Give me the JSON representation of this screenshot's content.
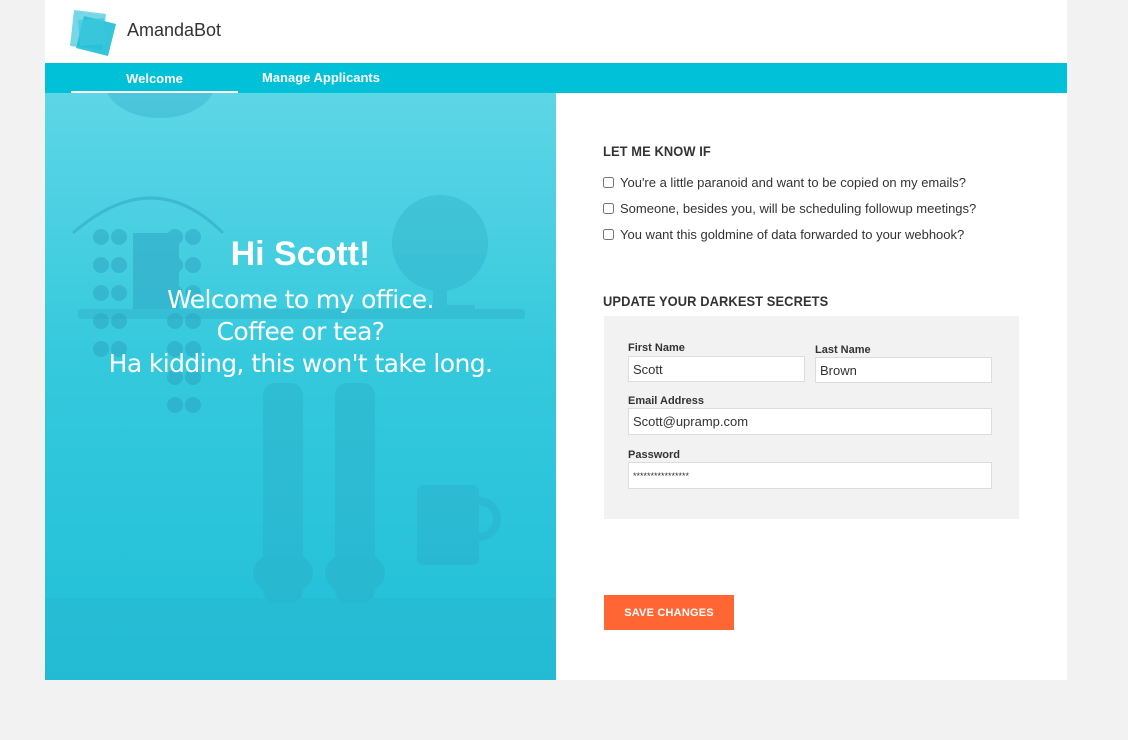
{
  "header": {
    "brand": "AmandaBot"
  },
  "nav": {
    "tabs": [
      {
        "label": "Welcome",
        "active": true
      },
      {
        "label": "Manage Applicants",
        "active": false
      }
    ]
  },
  "hero": {
    "title": "Hi Scott!",
    "lines": [
      "Welcome to my office.",
      "Coffee or tea?",
      "Ha kidding, this won't take long."
    ]
  },
  "notify": {
    "title": "LET ME KNOW IF",
    "options": [
      "You're a little paranoid and want to be copied on my emails?",
      "Someone, besides you, will be scheduling followup meetings?",
      "You want this goldmine of data forwarded to your webhook?"
    ]
  },
  "profile": {
    "title": "UPDATE YOUR DARKEST SECRETS",
    "first_name_label": "First Name",
    "first_name_value": "Scott",
    "last_name_label": "Last Name",
    "last_name_value": "Brown",
    "email_label": "Email Address",
    "email_value": "Scott@upramp.com",
    "password_label": "Password",
    "password_value": "****************"
  },
  "actions": {
    "save_label": "SAVE CHANGES"
  },
  "colors": {
    "accent": "#00c1d8",
    "button": "#ff6633",
    "panel": "#f2f2f2"
  }
}
